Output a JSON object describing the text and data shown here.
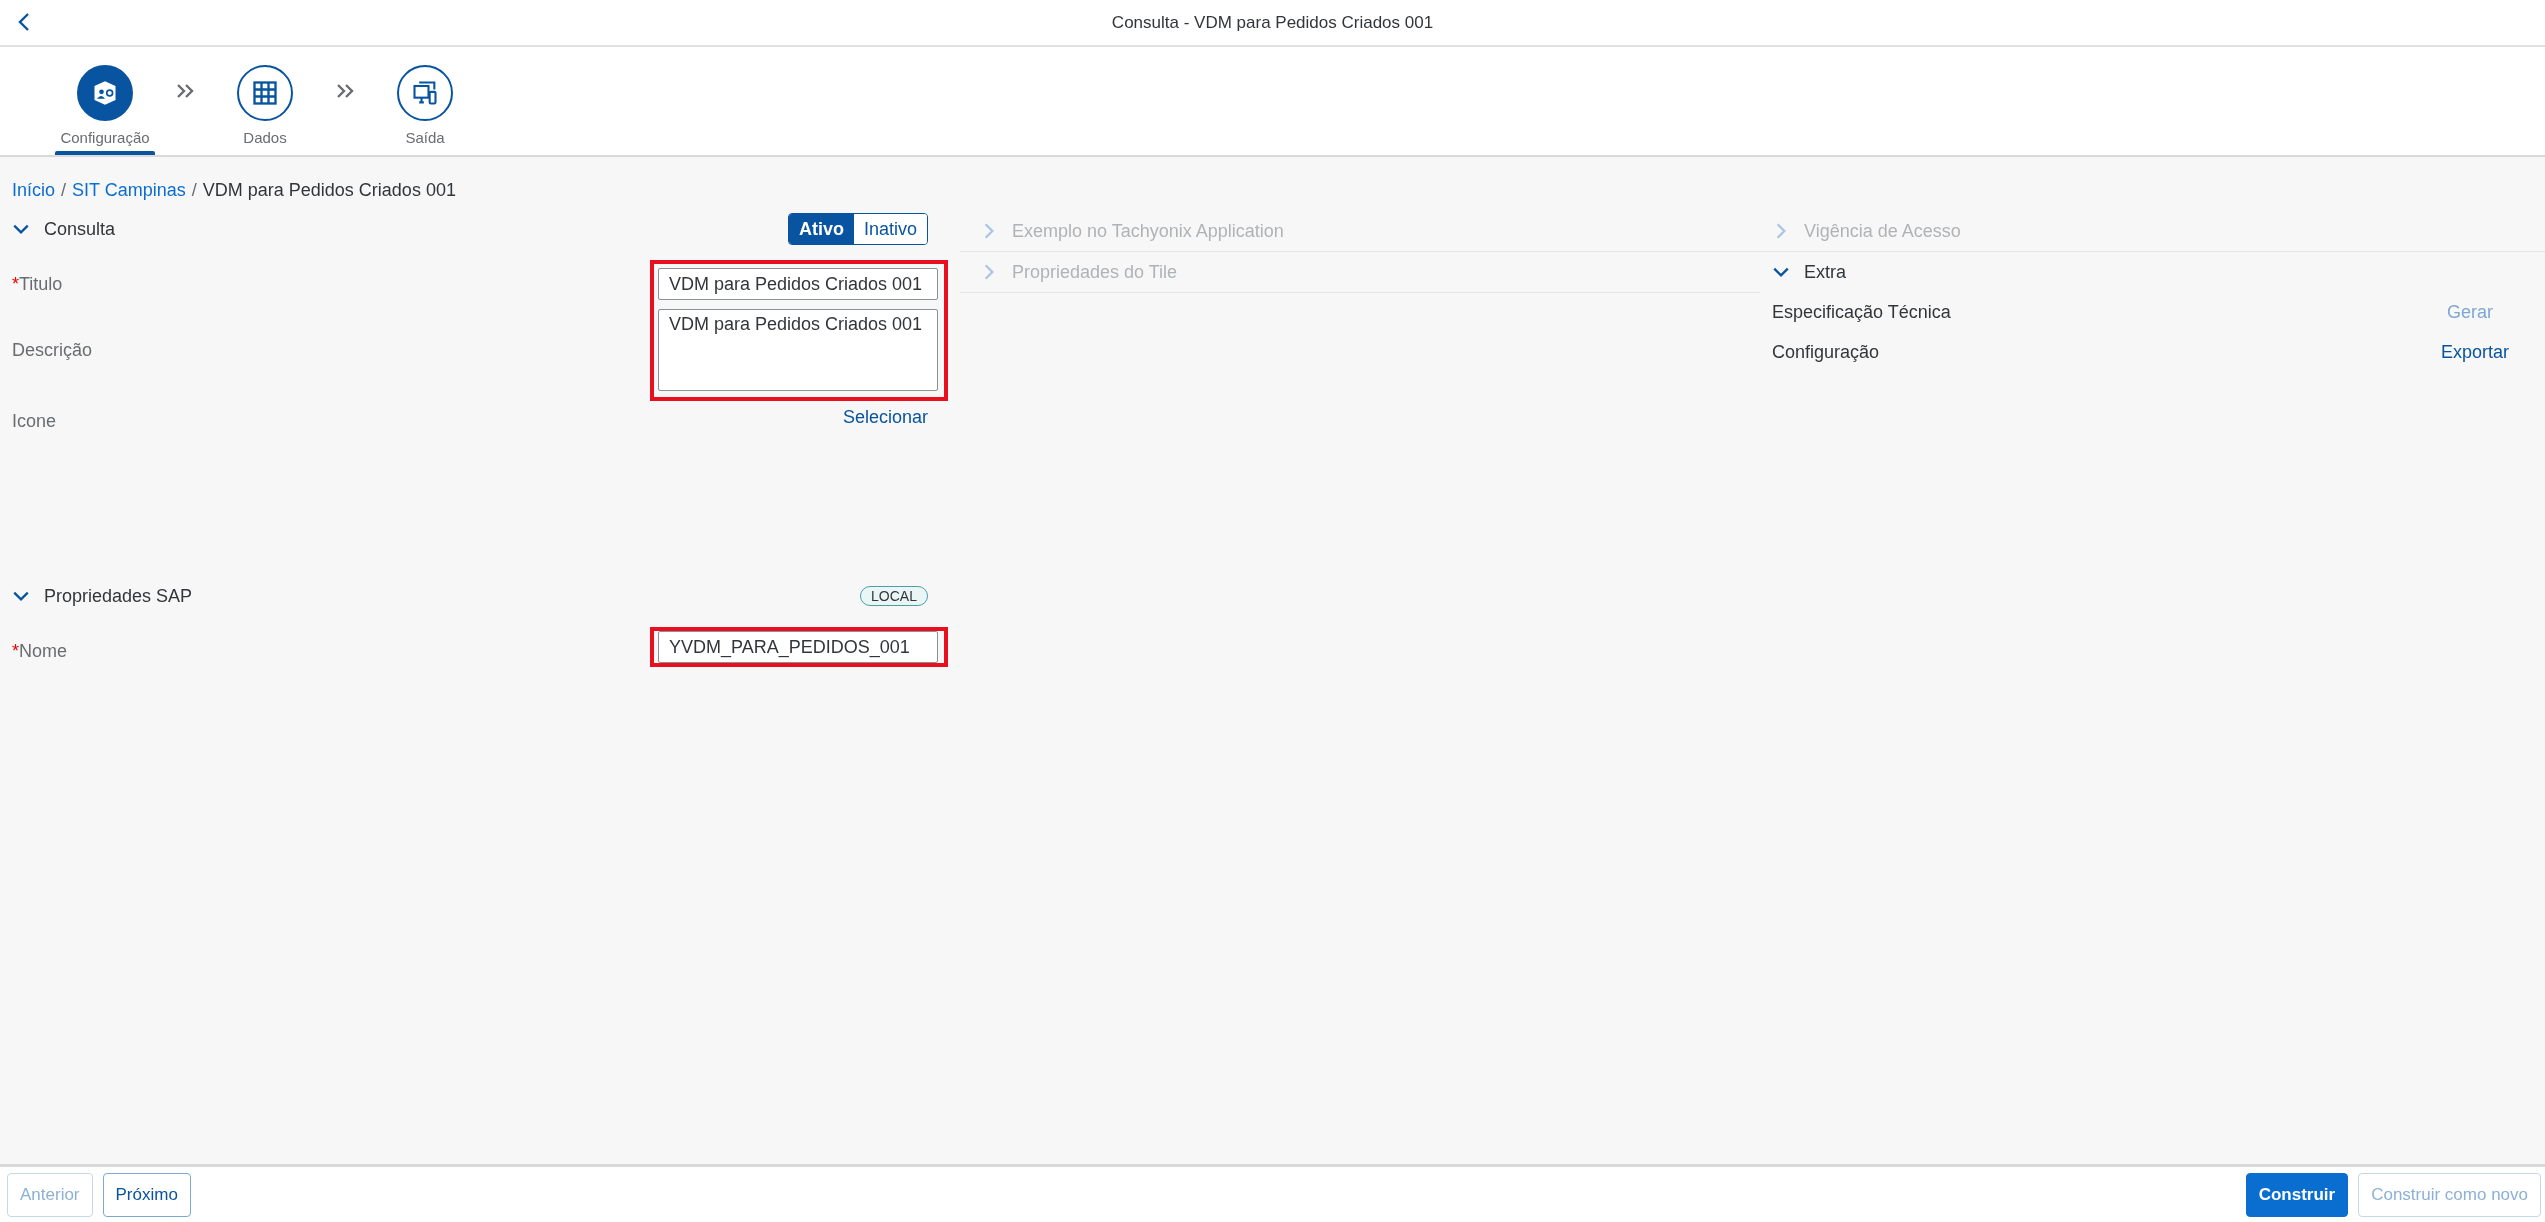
{
  "header": {
    "title": "Consulta - VDM para Pedidos Criados 001"
  },
  "steps": [
    {
      "label": "Configuração",
      "selected": true,
      "kind": "config"
    },
    {
      "label": "Dados",
      "selected": false,
      "kind": "data"
    },
    {
      "label": "Saída",
      "selected": false,
      "kind": "output"
    }
  ],
  "breadcrumb": [
    {
      "label": "Início",
      "kind": "link"
    },
    {
      "label": "/",
      "kind": "separator"
    },
    {
      "label": "SIT Campinas",
      "kind": "link"
    },
    {
      "label": "/",
      "kind": "separator"
    },
    {
      "label": "VDM para Pedidos Criados 001",
      "kind": "current"
    }
  ],
  "consulta": {
    "title": "Consulta",
    "expanded": true,
    "toggle": [
      {
        "label": "Ativo",
        "selected": true
      },
      {
        "label": "Inativo",
        "selected": false
      }
    ],
    "groups": [
      {
        "highlighted": true,
        "fields": [
          {
            "label": "Titulo",
            "required_mark": "*",
            "kind": "input",
            "value": "VDM para Pedidos Criados 001"
          },
          {
            "label": "Descrição",
            "kind": "textarea",
            "value": "VDM para Pedidos Criados 001"
          }
        ]
      },
      {
        "highlighted": false,
        "fields": [
          {
            "label": "Icone",
            "kind": "link",
            "value": "Selecionar"
          }
        ]
      }
    ]
  },
  "sap_properties": {
    "title": "Propriedades SAP",
    "expanded": true,
    "badge": "LOCAL",
    "groups": [
      {
        "highlighted": true,
        "fields": [
          {
            "label": "Nome",
            "required_mark": "*",
            "kind": "input",
            "value": "YVDM_PARA_PEDIDOS_001"
          }
        ]
      }
    ]
  },
  "middle_panels": [
    {
      "title": "Exemplo no Tachyonix Application",
      "expanded": false,
      "disabled": true
    },
    {
      "title": "Propriedades do Tile",
      "expanded": false,
      "disabled": true
    }
  ],
  "right_panels": [
    {
      "title": "Vigência de Acesso",
      "expanded": false,
      "disabled": true
    },
    {
      "title": "Extra",
      "expanded": true,
      "disabled": false,
      "items": [
        {
          "label": "Especificação Técnica",
          "action": "Gerar",
          "disabled": true
        },
        {
          "label": "Configuração",
          "action": "Exportar",
          "disabled": false
        }
      ]
    }
  ],
  "footer": {
    "left": [
      {
        "label": "Anterior",
        "disabled": true
      },
      {
        "label": "Próximo",
        "disabled": false
      }
    ],
    "right": [
      {
        "label": "Construir",
        "disabled": false,
        "emphasized": true
      },
      {
        "label": "Construir como novo",
        "disabled": true,
        "emphasized": false
      }
    ]
  }
}
